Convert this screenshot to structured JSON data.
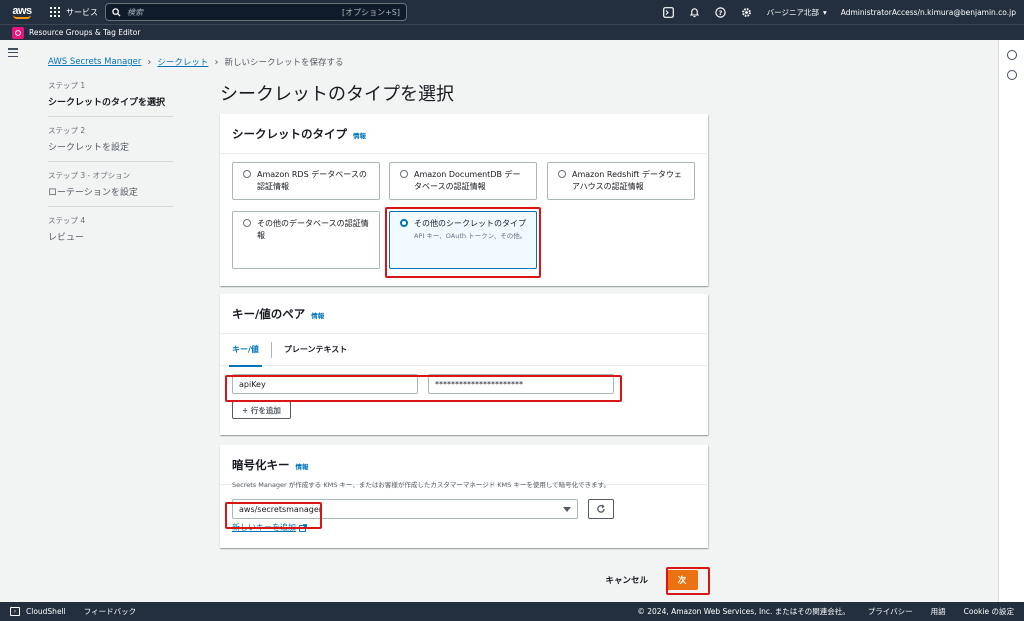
{
  "topnav": {
    "logo": "aws",
    "services": "サービス",
    "search_placeholder": "検索",
    "search_shortcut": "[オプション+S]",
    "region": "バージニア北部",
    "account": "AdministratorAccess/n.kimura@benjamin.co.jp",
    "icons": [
      "terminal-icon",
      "bell-icon",
      "help-icon",
      "gear-icon"
    ]
  },
  "subbar": {
    "label": "Resource Groups & Tag Editor"
  },
  "breadcrumb": {
    "items": [
      "AWS Secrets Manager",
      "シークレット"
    ],
    "current": "新しいシークレットを保存する"
  },
  "steps": [
    {
      "num": "ステップ 1",
      "name": "シークレットのタイプを選択"
    },
    {
      "num": "ステップ 2",
      "name": "シークレットを設定"
    },
    {
      "num": "ステップ 3 - オプション",
      "name": "ローテーションを設定"
    },
    {
      "num": "ステップ 4",
      "name": "レビュー"
    }
  ],
  "page_title": "シークレットのタイプを選択",
  "secret_type": {
    "heading": "シークレットのタイプ",
    "info": "情報",
    "options": [
      {
        "label": "Amazon RDS データベースの認証情報",
        "desc": ""
      },
      {
        "label": "Amazon DocumentDB データベースの認証情報",
        "desc": ""
      },
      {
        "label": "Amazon Redshift データウェアハウスの認証情報",
        "desc": ""
      },
      {
        "label": "その他のデータベースの認証情報",
        "desc": ""
      },
      {
        "label": "その他のシークレットのタイプ",
        "desc": "API キー、OAuth トークン、その他。"
      }
    ],
    "selected_index": 4
  },
  "kv": {
    "heading": "キー/値のペア",
    "info": "情報",
    "tabs": [
      "キー/値",
      "プレーンテキスト"
    ],
    "key_value": "apiKey",
    "secret_value": "**********************",
    "add_row": "+ 行を追加"
  },
  "encryption": {
    "heading": "暗号化キー",
    "info": "情報",
    "description": "Secrets Manager が作成する KMS キー、またはお客様が作成したカスタマーマネージド KMS キーを使用して暗号化できます。",
    "selected": "aws/secretsmanager",
    "add_key_link": "新しいキーを追加"
  },
  "actions": {
    "cancel": "キャンセル",
    "next": "次"
  },
  "footer": {
    "cloudshell": "CloudShell",
    "feedback": "フィードバック",
    "copyright": "© 2024, Amazon Web Services, Inc. またはその関連会社。",
    "privacy": "プライバシー",
    "terms": "用語",
    "cookie": "Cookie の設定"
  },
  "colors": {
    "nav_bg": "#232f3e",
    "accent_orange": "#ec7211",
    "link_blue": "#0073bb",
    "highlight_red": "#d91515"
  }
}
